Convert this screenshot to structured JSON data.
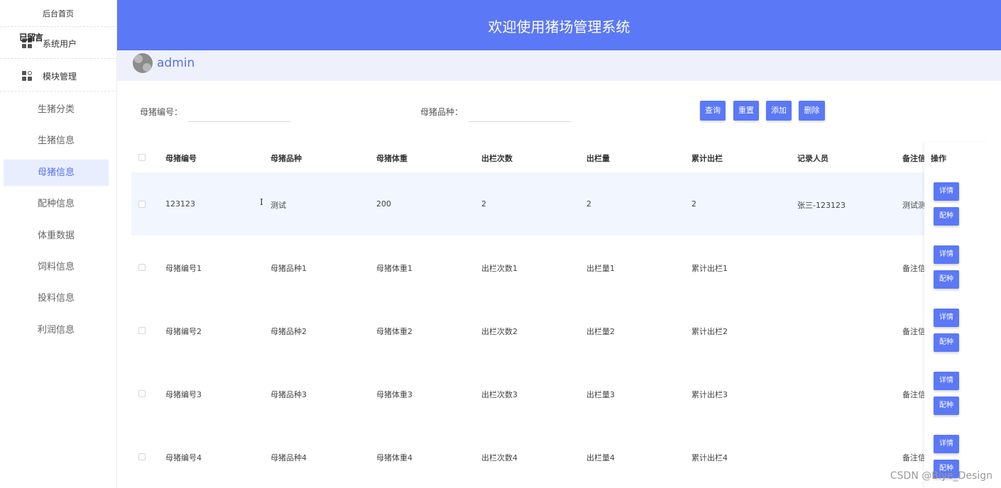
{
  "sidebar": {
    "home": "后台首页",
    "overlap_text": "已留言",
    "system_users": "系统用户",
    "module_mgmt": "模块管理",
    "items": [
      {
        "label": "生猪分类",
        "active": false
      },
      {
        "label": "生猪信息",
        "active": false
      },
      {
        "label": "母猪信息",
        "active": true
      },
      {
        "label": "配种信息",
        "active": false
      },
      {
        "label": "体重数据",
        "active": false
      },
      {
        "label": "饲料信息",
        "active": false
      },
      {
        "label": "投料信息",
        "active": false
      },
      {
        "label": "利润信息",
        "active": false
      }
    ]
  },
  "header": {
    "title": "欢迎使用猪场管理系统"
  },
  "user": {
    "name": "admin"
  },
  "search": {
    "field1_label": "母猪编号：",
    "field1_value": "",
    "field2_label": "母猪品种：",
    "field2_value": "",
    "query": "查询",
    "reset": "重置",
    "add": "添加",
    "delete": "删除"
  },
  "table": {
    "columns": [
      "母猪编号",
      "母猪品种",
      "母猪体重",
      "出栏次数",
      "出栏量",
      "累计出栏",
      "记录人员",
      "备注信",
      "操作"
    ],
    "rows": [
      [
        "123123",
        "测试",
        "200",
        "2",
        "2",
        "2",
        "张三-123123",
        "测试测"
      ],
      [
        "母猪编号1",
        "母猪品种1",
        "母猪体重1",
        "出栏次数1",
        "出栏量1",
        "累计出栏1",
        "",
        "备注信"
      ],
      [
        "母猪编号2",
        "母猪品种2",
        "母猪体重2",
        "出栏次数2",
        "出栏量2",
        "累计出栏2",
        "",
        "备注信"
      ],
      [
        "母猪编号3",
        "母猪品种3",
        "母猪体重3",
        "出栏次数3",
        "出栏量3",
        "累计出栏3",
        "",
        "备注信"
      ],
      [
        "母猪编号4",
        "母猪品种4",
        "母猪体重4",
        "出栏次数4",
        "出栏量4",
        "累计出栏4",
        "",
        "备注信"
      ]
    ],
    "detail_btn": "详情",
    "breed_btn": "配种"
  },
  "watermark": "CSDN @Biye_Design",
  "colors": {
    "primary": "#5b78f6",
    "active_bg": "#e9eeff",
    "row_highlight": "#f1f6ff"
  }
}
